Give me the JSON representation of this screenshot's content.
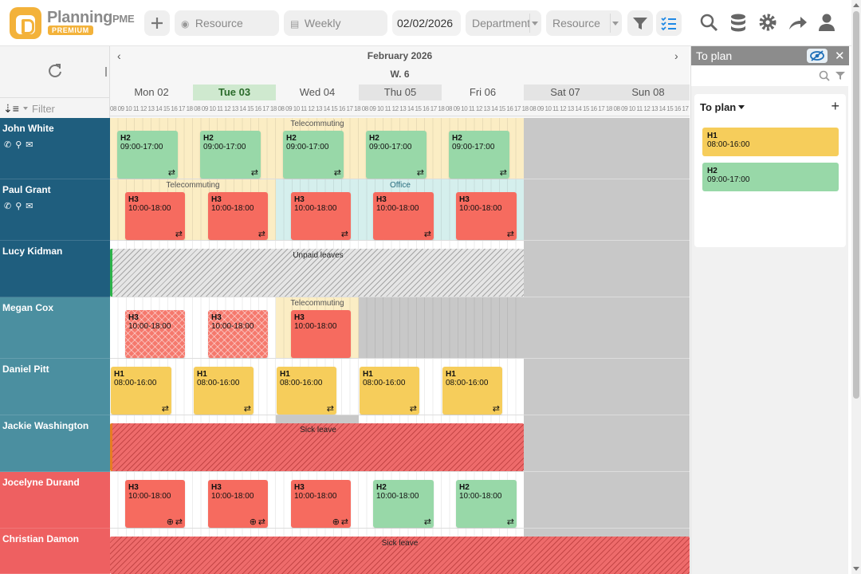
{
  "app": {
    "brand": "Planning",
    "brand_suffix": "PME",
    "badge": "PREMIUM"
  },
  "toolbar": {
    "add_icon": "plus-icon",
    "resource_placeholder": "Resource",
    "view_mode": "Weekly",
    "date": "02/02/2026",
    "department": "Department",
    "resource_select": "Resource",
    "tools": [
      "filter-icon",
      "task-list-icon",
      "search-icon",
      "database-icon",
      "settings-icon",
      "share-icon",
      "user-icon"
    ]
  },
  "calendar": {
    "month": "February 2026",
    "week": "W. 6",
    "filter_placeholder": "Filter",
    "days": [
      "Mon 02",
      "Tue 03",
      "Wed 04",
      "Thu 05",
      "Fri 06",
      "Sat 07",
      "Sun 08"
    ],
    "hours": "08 09 10 11 12 13 14 15 16 17 18"
  },
  "resources": [
    {
      "name": "John White",
      "color": "#1f5e7e",
      "contact_icons": [
        "phone-icon",
        "location-icon",
        "email-icon"
      ]
    },
    {
      "name": "Paul Grant",
      "color": "#1f5e7e",
      "contact_icons": [
        "phone-icon",
        "location-icon",
        "email-icon"
      ]
    },
    {
      "name": "Lucy Kidman",
      "color": "#1f5e7e"
    },
    {
      "name": "Megan Cox",
      "color": "#4b8fa0"
    },
    {
      "name": "Daniel Pitt",
      "color": "#4b8fa0"
    },
    {
      "name": "Jackie Washington",
      "color": "#4b8fa0"
    },
    {
      "name": "Jocelyne Durand",
      "color": "#ee6061"
    },
    {
      "name": "Christian Damon",
      "color": "#ee6061"
    }
  ],
  "labels": {
    "telecommuting": "Telecommuting",
    "office": "Office",
    "unpaid": "Unpaid leaves",
    "sick": "Sick leave"
  },
  "tasks": {
    "h1": {
      "code": "H1",
      "time": "08:00-16:00"
    },
    "h2": {
      "code": "H2",
      "time": "09:00-17:00"
    },
    "h2b": {
      "code": "H2",
      "time": "10:00-18:00"
    },
    "h3": {
      "code": "H3",
      "time": "10:00-18:00"
    }
  },
  "panel": {
    "title": "To plan",
    "section": "To plan",
    "items": [
      {
        "code": "H1",
        "time": "08:00-16:00",
        "color": "#f6cd5b"
      },
      {
        "code": "H2",
        "time": "09:00-17:00",
        "color": "#98d8a8"
      }
    ]
  }
}
